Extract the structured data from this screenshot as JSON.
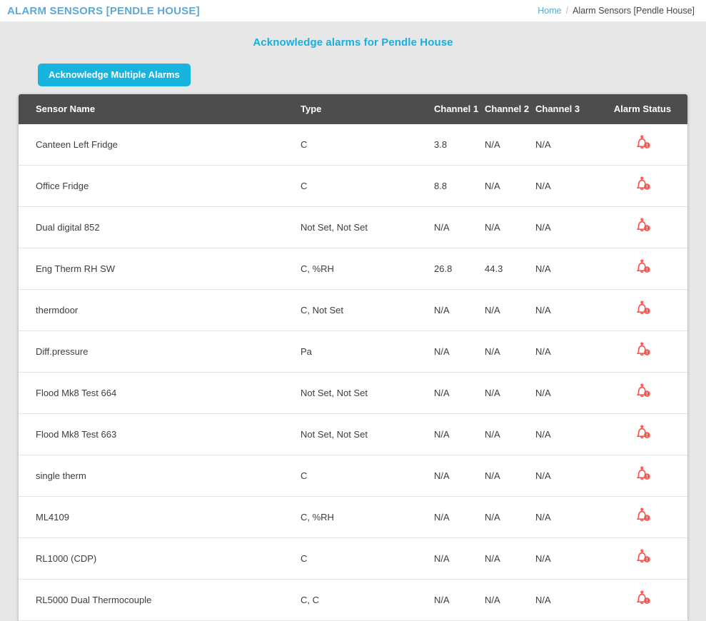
{
  "topbar": {
    "title": "ALARM SENSORS [PENDLE HOUSE]",
    "breadcrumb": {
      "home_label": "Home",
      "separator": "/",
      "current_label": "Alarm Sensors [Pendle House]"
    }
  },
  "page": {
    "subtitle": "Acknowledge alarms for Pendle House",
    "acknowledge_button_label": "Acknowledge Multiple Alarms"
  },
  "table": {
    "columns": [
      "Sensor Name",
      "Type",
      "Channel 1",
      "Channel 2",
      "Channel 3",
      "Alarm Status"
    ],
    "rows": [
      {
        "name": "Canteen Left Fridge",
        "type": "C",
        "ch1": "3.8",
        "ch2": "N/A",
        "ch3": "N/A",
        "status_icon": "alarm-bell-warning-icon"
      },
      {
        "name": "Office Fridge",
        "type": "C",
        "ch1": "8.8",
        "ch2": "N/A",
        "ch3": "N/A",
        "status_icon": "alarm-bell-warning-icon"
      },
      {
        "name": "Dual digital 852",
        "type": "Not Set, Not Set",
        "ch1": "N/A",
        "ch2": "N/A",
        "ch3": "N/A",
        "status_icon": "alarm-bell-warning-icon"
      },
      {
        "name": "Eng Therm RH SW",
        "type": "C, %RH",
        "ch1": "26.8",
        "ch2": "44.3",
        "ch3": "N/A",
        "status_icon": "alarm-bell-warning-icon"
      },
      {
        "name": "thermdoor",
        "type": "C, Not Set",
        "ch1": "N/A",
        "ch2": "N/A",
        "ch3": "N/A",
        "status_icon": "alarm-bell-warning-icon"
      },
      {
        "name": "Diff.pressure",
        "type": "Pa",
        "ch1": "N/A",
        "ch2": "N/A",
        "ch3": "N/A",
        "status_icon": "alarm-bell-warning-icon"
      },
      {
        "name": "Flood Mk8 Test 664",
        "type": "Not Set, Not Set",
        "ch1": "N/A",
        "ch2": "N/A",
        "ch3": "N/A",
        "status_icon": "alarm-bell-warning-icon"
      },
      {
        "name": "Flood Mk8 Test 663",
        "type": "Not Set, Not Set",
        "ch1": "N/A",
        "ch2": "N/A",
        "ch3": "N/A",
        "status_icon": "alarm-bell-warning-icon"
      },
      {
        "name": "single therm",
        "type": "C",
        "ch1": "N/A",
        "ch2": "N/A",
        "ch3": "N/A",
        "status_icon": "alarm-bell-warning-icon"
      },
      {
        "name": "ML4109",
        "type": "C, %RH",
        "ch1": "N/A",
        "ch2": "N/A",
        "ch3": "N/A",
        "status_icon": "alarm-bell-warning-icon"
      },
      {
        "name": "RL1000 (CDP)",
        "type": "C",
        "ch1": "N/A",
        "ch2": "N/A",
        "ch3": "N/A",
        "status_icon": "alarm-bell-warning-icon"
      },
      {
        "name": "RL5000 Dual Thermocouple",
        "type": "C, C",
        "ch1": "N/A",
        "ch2": "N/A",
        "ch3": "N/A",
        "status_icon": "alarm-bell-warning-icon"
      }
    ]
  },
  "colors": {
    "header_title": "#5fa8d3",
    "subtitle": "#15b0e0",
    "button": "#18b4e0",
    "table_header": "#4d4d4d",
    "alarm_icon": "#f9564f",
    "page_background": "#e7e7e7"
  }
}
